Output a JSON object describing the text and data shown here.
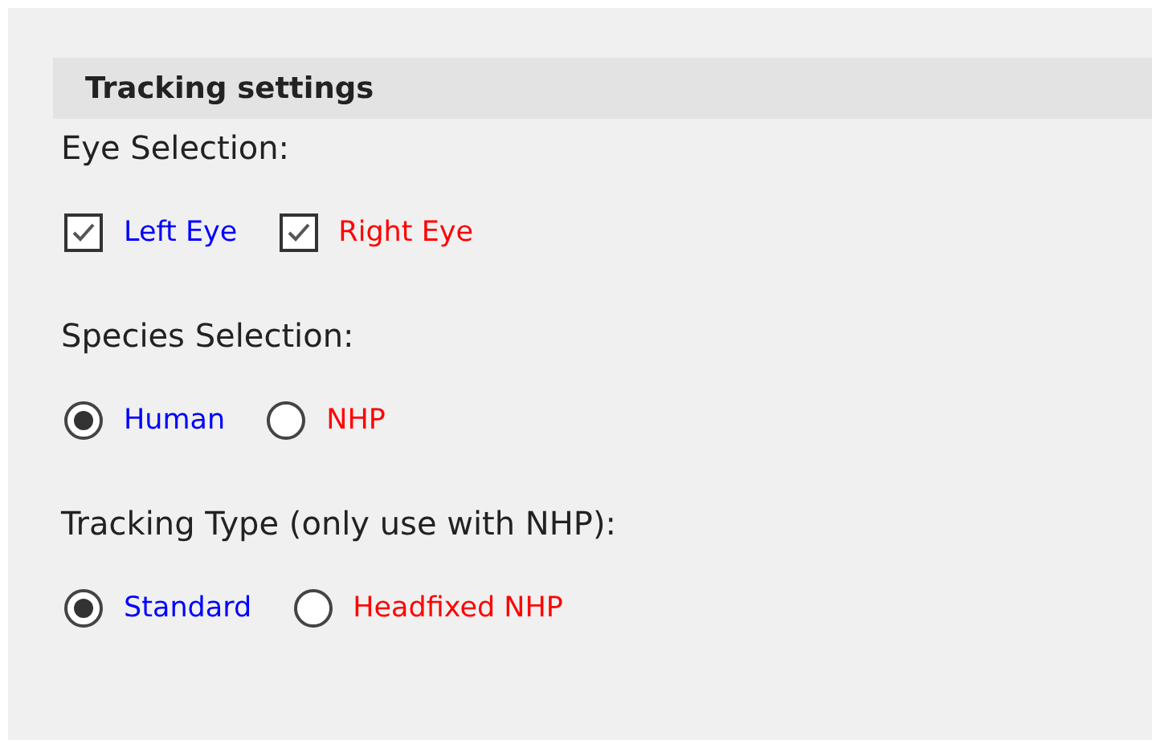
{
  "section": {
    "title": "Tracking settings"
  },
  "groups": [
    {
      "label": "Eye Selection:",
      "kind": "checkbox",
      "options": [
        {
          "label": "Left Eye",
          "checked": true,
          "color": "#0000ff"
        },
        {
          "label": "Right Eye",
          "checked": true,
          "color": "#ff0000"
        }
      ]
    },
    {
      "label": "Species Selection:",
      "kind": "radio",
      "options": [
        {
          "label": "Human",
          "selected": true,
          "color": "#0000ff"
        },
        {
          "label": "NHP",
          "selected": false,
          "color": "#ff0000"
        }
      ]
    },
    {
      "label": "Tracking Type (only use with NHP):",
      "kind": "radio",
      "options": [
        {
          "label": "Standard",
          "selected": true,
          "color": "#0000ff"
        },
        {
          "label": "Headfixed NHP",
          "selected": false,
          "color": "#ff0000"
        }
      ]
    }
  ]
}
